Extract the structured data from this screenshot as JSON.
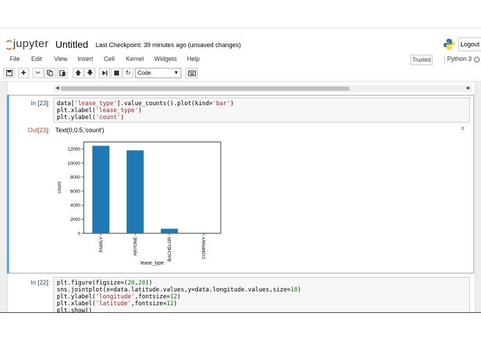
{
  "header": {
    "logo_text": "jupyter",
    "notebook_title": "Untitled",
    "checkpoint": "Last Checkpoint: 39 minutes ago (unsaved changes)",
    "logout_label": "Logout"
  },
  "menubar": {
    "items": [
      "File",
      "Edit",
      "View",
      "Insert",
      "Cell",
      "Kernel",
      "Widgets",
      "Help"
    ],
    "trusted": "Trusted",
    "kernel": "Python 3"
  },
  "toolbar": {
    "cell_type": "Code",
    "icons": [
      "save-icon",
      "plus-icon",
      "cut-icon",
      "copy-icon",
      "paste-icon",
      "arrow-up-icon",
      "arrow-down-icon",
      "step-forward-icon",
      "stop-icon",
      "restart-icon",
      "keyboard-icon"
    ]
  },
  "cells": [
    {
      "prompt": "In  [23]:",
      "lines": [
        "data['lease_type'].value_counts().plot(kind='bar')",
        "plt.xlabel('lease_type')",
        "plt.ylabel('count')"
      ]
    },
    {
      "prompt": "In  [22]:",
      "lines": [
        "plt.figure(figsize=(20,20))",
        "sns.jointplot(x=data.latitude.values,y=data.longitude.values,size=10)",
        "plt.ylabel('longitude',fontsize=12)",
        "plt.xlabel('latitude',fontsize=12)",
        "plt.show()"
      ]
    }
  ],
  "output": {
    "prompt": "Out[23]:",
    "text": "Text(0,0.5,'count')"
  },
  "chart_data": {
    "type": "bar",
    "categories": [
      "FAMILY",
      "ANYONE",
      "BACHELOR",
      "COMPANY"
    ],
    "values": [
      12450,
      11800,
      650,
      70
    ],
    "xlabel": "lease_type",
    "ylabel": "count",
    "ylim": [
      0,
      13000
    ],
    "yticks": [
      0,
      2000,
      4000,
      6000,
      8000,
      10000,
      12000
    ],
    "bar_color": "#1f77b4",
    "grid": false
  },
  "colors": {
    "selected_cell_bar": "#42a5f5",
    "in_prompt": "#303f9f",
    "out_prompt": "#d84315",
    "jupyter_orange": "#f37726"
  }
}
